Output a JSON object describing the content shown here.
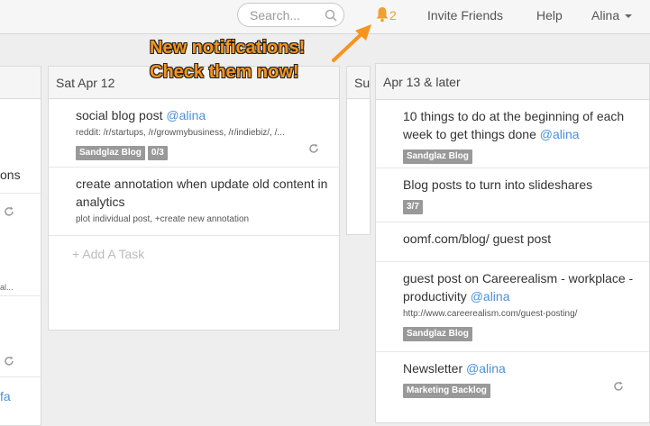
{
  "header": {
    "search_placeholder": "Search...",
    "notification_count": "2",
    "nav": [
      "Invite Friends",
      "Help",
      "Alina"
    ]
  },
  "callout": {
    "line1": "New notifications!",
    "line2": "Check them now!"
  },
  "left_partial": {
    "fragments": [
      "ons",
      "al...",
      "fa"
    ]
  },
  "col_sat": {
    "title": "Sat Apr 12",
    "tasks": [
      {
        "text": "social blog post ",
        "mention": "@alina",
        "meta": "reddit: /r/startups, /r/growmybusiness,  /r/indiebiz/, /...",
        "tags": [
          "Sandglaz Blog",
          "0/3"
        ]
      },
      {
        "text": "create annotation when update old content in analytics",
        "meta": "plot individual post, +create new annotation"
      }
    ],
    "add_task": "+ Add A Task"
  },
  "col_sun": {
    "title": "Su"
  },
  "col_later": {
    "title": "Apr 13 & later",
    "tasks": [
      {
        "text": "10 things to do at the beginning of each week to get things done ",
        "mention": "@alina",
        "tags": [
          "Sandglaz Blog"
        ]
      },
      {
        "text": "Blog posts to turn into slideshares",
        "tags": [
          "3/7"
        ]
      },
      {
        "text": "oomf.com/blog/ guest post"
      },
      {
        "text": "guest post on Careerealism - workplace - productivity ",
        "mention": "@alina",
        "meta": "http://www.careerealism.com/guest-posting/",
        "tags": [
          "Sandglaz Blog"
        ]
      },
      {
        "text": "Newsletter ",
        "mention": "@alina",
        "tags": [
          "Marketing Backlog"
        ]
      }
    ]
  }
}
